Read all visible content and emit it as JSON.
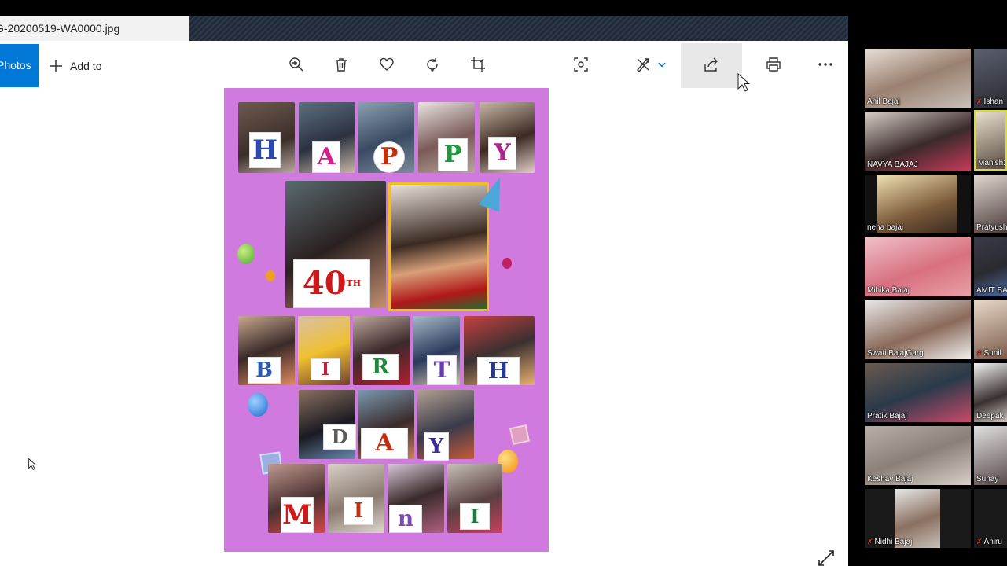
{
  "tab": {
    "filename": "G-20200519-WA0000.jpg"
  },
  "toolbar": {
    "photos_label": "Photos",
    "add_to_label": "Add to"
  },
  "card": {
    "word_happy": [
      "H",
      "A",
      "P",
      "P",
      "Y"
    ],
    "age": "40",
    "age_suffix": "TH",
    "word_birthday": [
      "B",
      "I",
      "R",
      "T",
      "H"
    ],
    "word_day": [
      "D",
      "A",
      "Y"
    ],
    "word_name": [
      "M",
      "I",
      "n",
      "I"
    ]
  },
  "participants": [
    {
      "name": "Anil Bajaj",
      "muted": false
    },
    {
      "name": "Ishan",
      "muted": true
    },
    {
      "name": "NAVYA BAJAJ",
      "muted": false
    },
    {
      "name": "Manish2",
      "muted": false
    },
    {
      "name": "neha bajaj",
      "muted": false
    },
    {
      "name": "Pratyush",
      "muted": false
    },
    {
      "name": "Mihika Bajaj",
      "muted": false
    },
    {
      "name": "AMIT BA",
      "muted": false
    },
    {
      "name": "Swati BajajGarg",
      "muted": false
    },
    {
      "name": "Sunil",
      "muted": true
    },
    {
      "name": "Pratik Bajaj",
      "muted": false
    },
    {
      "name": "Deepak",
      "muted": false
    },
    {
      "name": "Keshav Bajaj",
      "muted": false
    },
    {
      "name": "Sunay",
      "muted": false
    },
    {
      "name": "Nidhi Bajaj",
      "muted": true
    },
    {
      "name": "Aniru",
      "muted": true
    }
  ],
  "colors": {
    "accent": "#0078d7",
    "card_bg": "#d07ae0",
    "tab_strip": "#253040"
  }
}
